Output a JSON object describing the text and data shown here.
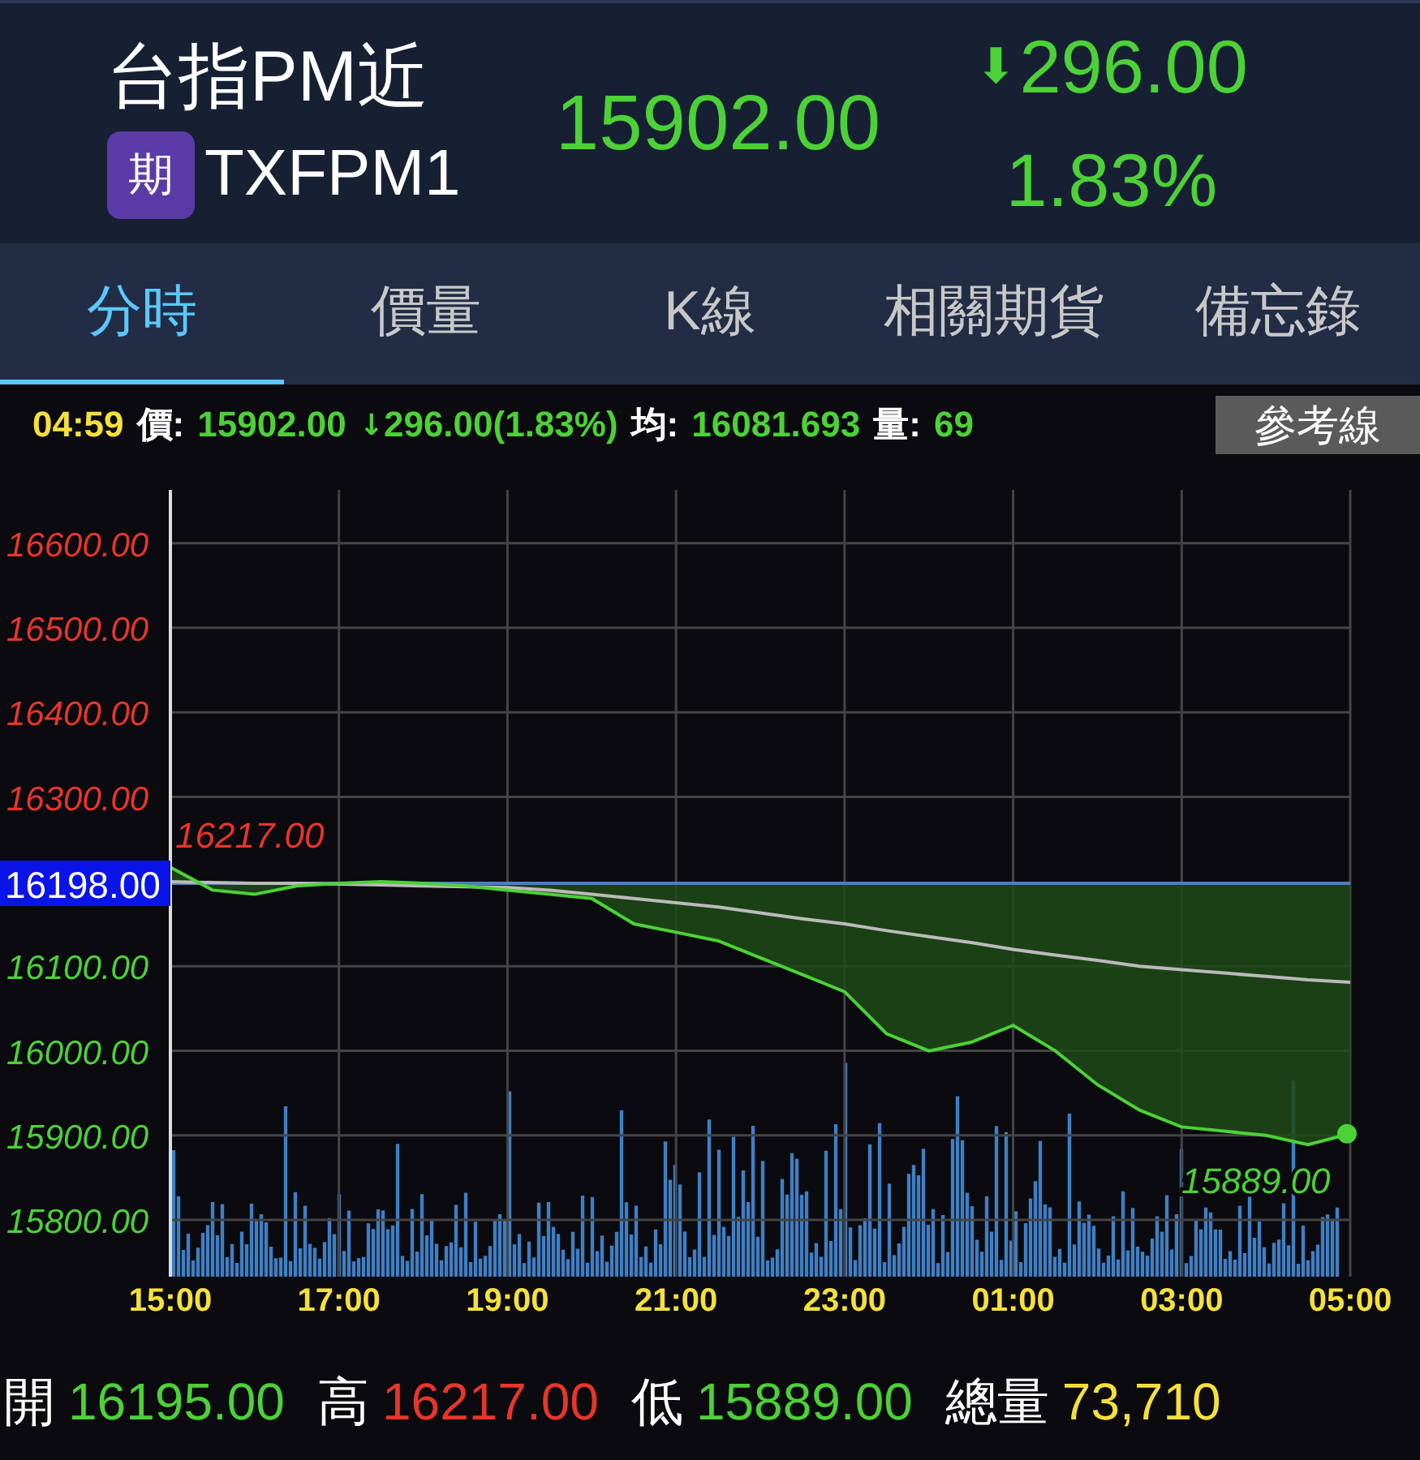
{
  "header": {
    "name": "台指PM近",
    "badge": "期",
    "code": "TXFPM1",
    "price": "15902.00",
    "arrow": "⬇",
    "change": "296.00",
    "percent": "1.83%"
  },
  "tabs": [
    {
      "label": "分時",
      "selected": true
    },
    {
      "label": "價量",
      "selected": false
    },
    {
      "label": "K線",
      "selected": false
    },
    {
      "label": "相關期貨",
      "selected": false
    },
    {
      "label": "備忘錄",
      "selected": false
    }
  ],
  "info": {
    "time": "04:59",
    "price_label": "價:",
    "price": "15902.00",
    "arrow": "↓",
    "change": "296.00(1.83%)",
    "avg_label": "均:",
    "avg": "16081.693",
    "volume_label": "量:",
    "volume": "69",
    "button": "參考線"
  },
  "chart": {
    "chart_data": {
      "type": "line",
      "grid": true,
      "ref_lines": [
        {
          "axis": "y",
          "value": 16198,
          "label": "16198.00"
        }
      ],
      "categories": [
        "15:00",
        null,
        null,
        null,
        "17:00",
        null,
        null,
        null,
        "19:00",
        null,
        null,
        null,
        "21:00",
        null,
        null,
        null,
        "23:00",
        null,
        null,
        null,
        "01:00",
        null,
        null,
        null,
        "03:00",
        null,
        null,
        null,
        "05:00"
      ],
      "series": [
        {
          "color": "#4cd137",
          "values": [
            16217,
            16190,
            16185,
            16195,
            16198,
            16200,
            16198,
            16195,
            16190,
            16185,
            16180,
            16150,
            16140,
            16130,
            16110,
            16090,
            16070,
            16020,
            16000,
            16010,
            16030,
            16000,
            15960,
            15930,
            15910,
            15905,
            15900,
            15889,
            15902
          ]
        },
        {
          "color": "#bbbbbb",
          "values": [
            16200,
            16199,
            16198,
            16198,
            16197,
            16196,
            16195,
            16194,
            16193,
            16190,
            16185,
            16180,
            16175,
            16170,
            16163,
            16156,
            16150,
            16142,
            16135,
            16128,
            16120,
            16113,
            16107,
            16100,
            16096,
            16092,
            16088,
            16084,
            16081
          ]
        }
      ],
      "ylim": [
        15733,
        16663
      ],
      "yticks": [
        {
          "value": 16600,
          "label": "16600.00"
        },
        {
          "value": 16500,
          "label": "16500.00"
        },
        {
          "value": 16400,
          "label": "16400.00"
        },
        {
          "value": 16300,
          "label": "16300.00"
        },
        {
          "value": 16100,
          "label": "16100.00"
        },
        {
          "value": 16000,
          "label": "16000.00"
        },
        {
          "value": 15900,
          "label": "15900.00"
        },
        {
          "value": 15800,
          "label": "15800.00"
        }
      ],
      "annotations": [
        "16217.00",
        "15889.00"
      ]
    }
  },
  "stats": [
    {
      "label": "開",
      "value": "16195.00",
      "kind": "down"
    },
    {
      "label": "高",
      "value": "16217.00",
      "kind": "up"
    },
    {
      "label": "低",
      "value": "15889.00",
      "kind": "down"
    },
    {
      "label": "總量",
      "value": "73,710",
      "kind": "volume"
    }
  ]
}
